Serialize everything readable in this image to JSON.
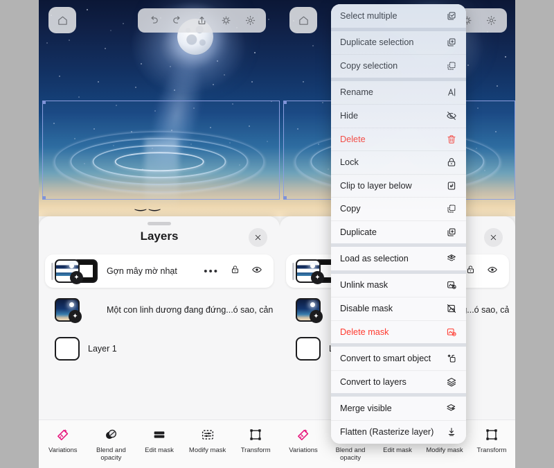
{
  "background_color": "#b3b3b3",
  "app": {
    "toolbar": {
      "home_label": "Home",
      "icons": [
        "home-icon",
        "undo-icon",
        "redo-icon",
        "share-icon",
        "lightbulb-icon",
        "settings-gear-icon"
      ]
    },
    "canvas": {
      "description": "Night sky with full moon, milky way and water ripple reflection",
      "selection_active": true
    },
    "layers_panel": {
      "title": "Layers",
      "close_label": "×",
      "rows": [
        {
          "name": "Gợn mây mờ nhạt",
          "selected": true,
          "has_mask": true,
          "more_label": "•••",
          "lock_icon": "unlock-icon",
          "visibility_icon": "eye-icon"
        },
        {
          "name": "Một con linh dương đang đứng...ó sao, cảnh vật nên thơ trữ tình",
          "selected": false,
          "has_mask": false
        },
        {
          "name": "Layer 1",
          "selected": false,
          "has_mask": false
        }
      ]
    },
    "bottom_bar": {
      "items": [
        {
          "label": "Variations",
          "icon": "variations-icon",
          "color": "#e8177d"
        },
        {
          "label": "Blend and opacity",
          "icon": "blend-opacity-icon",
          "color": "#1c1c1e"
        },
        {
          "label": "Edit mask",
          "icon": "edit-mask-icon",
          "color": "#1c1c1e"
        },
        {
          "label": "Modify mask",
          "icon": "modify-mask-icon",
          "color": "#1c1c1e"
        },
        {
          "label": "Transform",
          "icon": "transform-icon",
          "color": "#1c1c1e"
        }
      ]
    }
  },
  "context_menu": {
    "danger_color": "#ff3b30",
    "groups": [
      {
        "items": [
          {
            "label": "Select multiple",
            "icon": "select-multiple-icon",
            "danger": false
          }
        ]
      },
      {
        "items": [
          {
            "label": "Duplicate selection",
            "icon": "duplicate-selection-icon",
            "danger": false
          },
          {
            "label": "Copy selection",
            "icon": "copy-selection-icon",
            "danger": false
          }
        ]
      },
      {
        "items": [
          {
            "label": "Rename",
            "icon": "rename-icon",
            "danger": false
          },
          {
            "label": "Hide",
            "icon": "hide-eye-icon",
            "danger": false
          },
          {
            "label": "Delete",
            "icon": "trash-icon",
            "danger": true
          },
          {
            "label": "Lock",
            "icon": "lock-icon",
            "danger": false
          },
          {
            "label": "Clip to layer below",
            "icon": "clip-layer-icon",
            "danger": false
          },
          {
            "label": "Copy",
            "icon": "copy-icon",
            "danger": false
          },
          {
            "label": "Duplicate",
            "icon": "duplicate-icon",
            "danger": false
          }
        ]
      },
      {
        "items": [
          {
            "label": "Load as selection",
            "icon": "load-selection-icon",
            "danger": false
          }
        ]
      },
      {
        "items": [
          {
            "label": "Unlink mask",
            "icon": "unlink-mask-icon",
            "danger": false
          },
          {
            "label": "Disable mask",
            "icon": "disable-mask-icon",
            "danger": false
          },
          {
            "label": "Delete mask",
            "icon": "delete-mask-icon",
            "danger": true
          }
        ]
      },
      {
        "items": [
          {
            "label": "Convert to smart object",
            "icon": "smart-object-icon",
            "danger": false
          },
          {
            "label": "Convert to layers",
            "icon": "layers-icon",
            "danger": false
          }
        ]
      },
      {
        "items": [
          {
            "label": "Merge visible",
            "icon": "merge-visible-icon",
            "danger": false
          },
          {
            "label": "Flatten (Rasterize layer)",
            "icon": "flatten-icon",
            "danger": false
          }
        ]
      }
    ]
  }
}
